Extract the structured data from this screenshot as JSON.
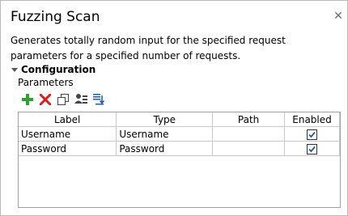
{
  "panel": {
    "title": "Fuzzing Scan",
    "description": "Generates totally random input for the specified request parameters for a specified number of requests.",
    "section_label": "Configuration",
    "subsection_label": "Parameters"
  },
  "toolbar": {
    "icons": [
      "add-icon",
      "delete-icon",
      "copy-icon",
      "add-from-request-icon",
      "sort-icon"
    ]
  },
  "table": {
    "columns": [
      "Label",
      "Type",
      "Path",
      "Enabled"
    ],
    "rows": [
      {
        "label": "Username",
        "type": "Username",
        "path": "",
        "enabled": true
      },
      {
        "label": "Password",
        "type": "Password",
        "path": "",
        "enabled": true
      }
    ]
  },
  "colors": {
    "add": "#2ea12e",
    "delete": "#d42020",
    "check": "#1e5aa8"
  }
}
